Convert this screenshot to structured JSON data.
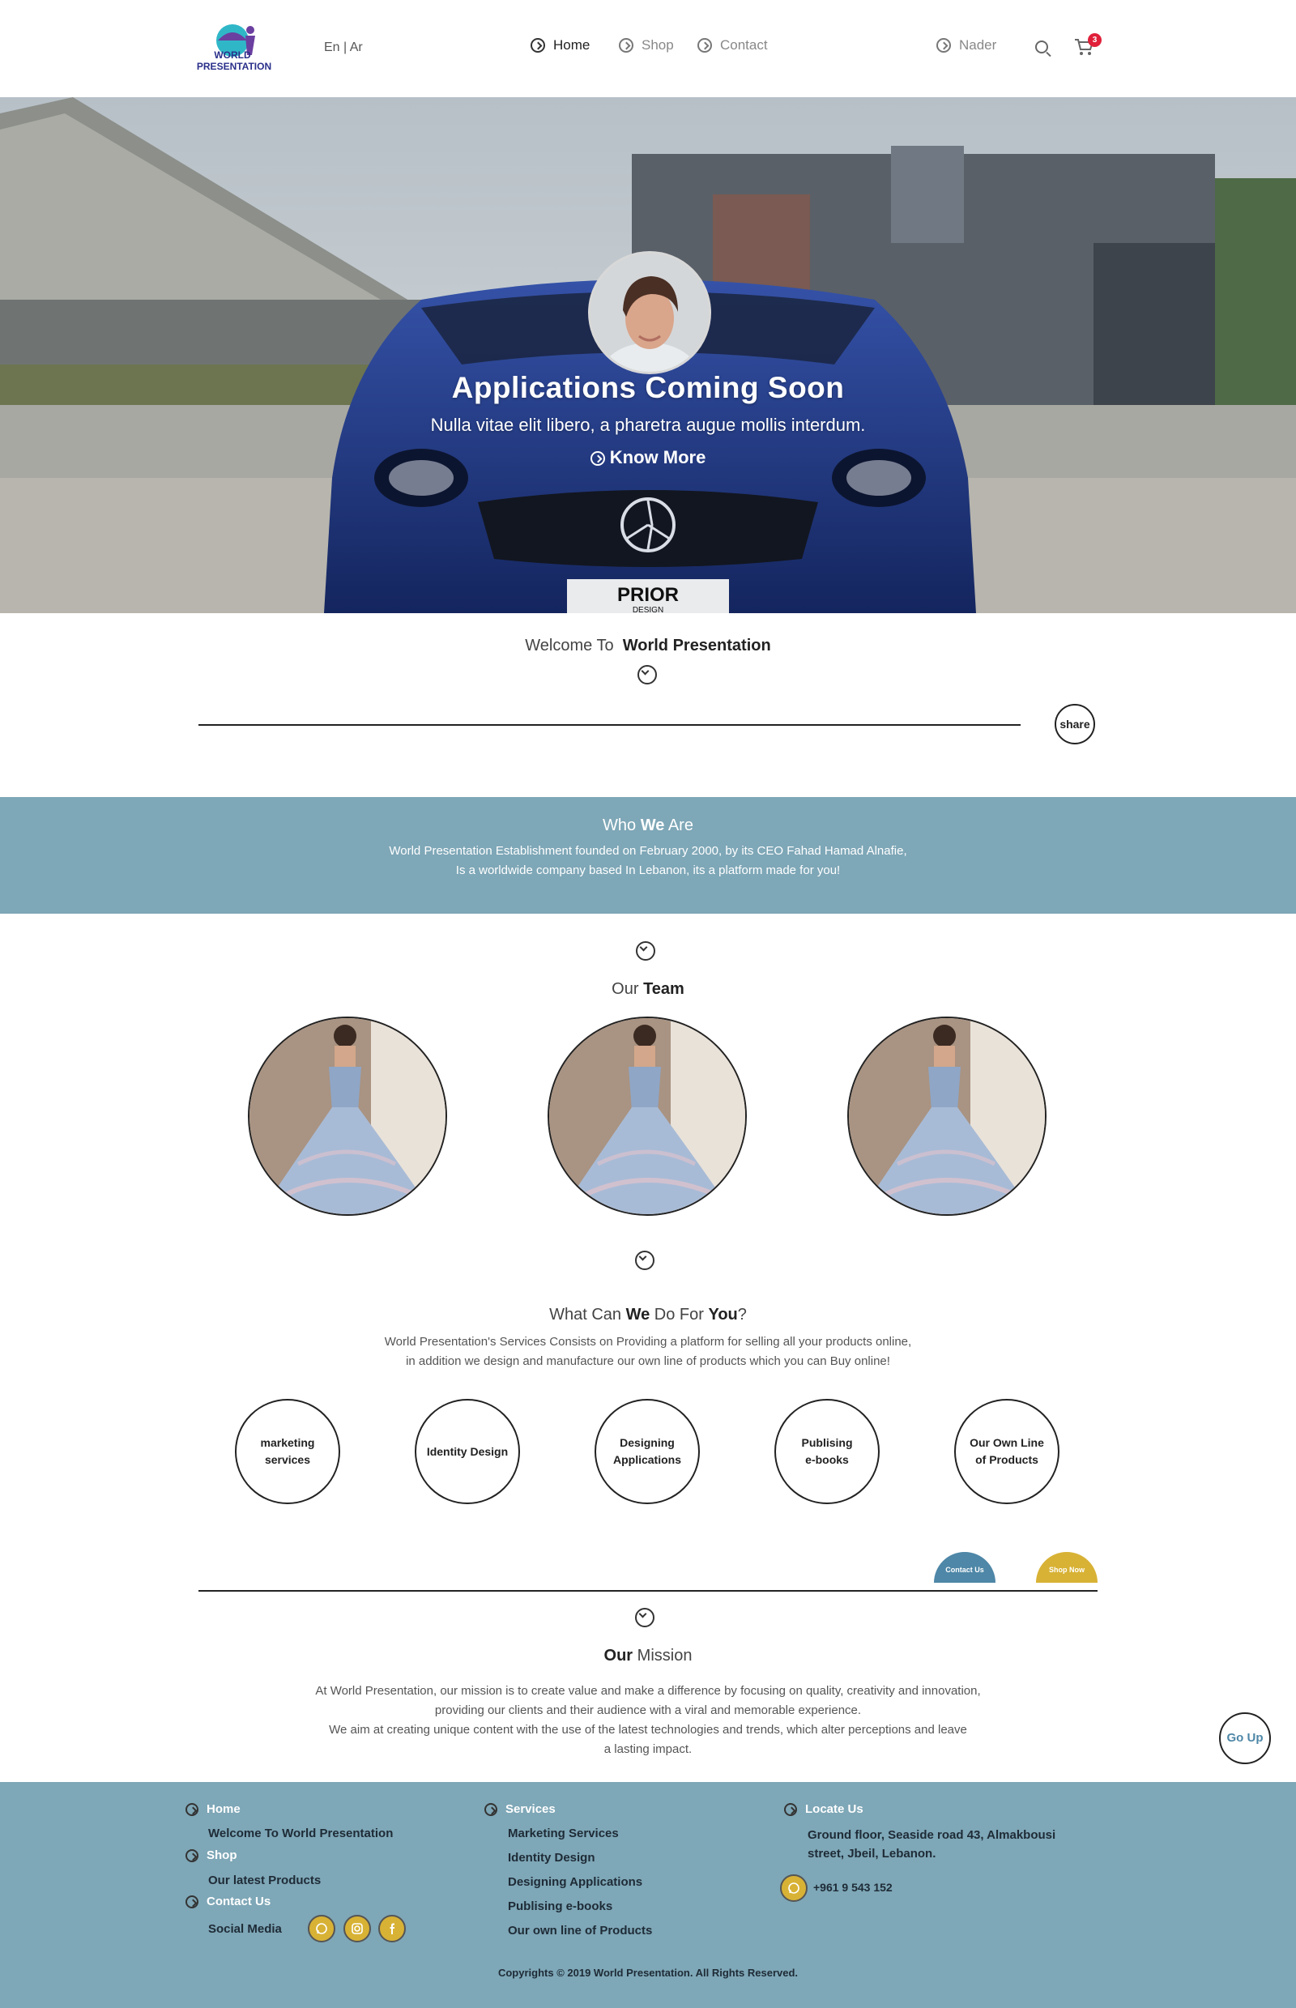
{
  "header": {
    "logo_text_top": "WORLD",
    "logo_text_bottom": "PRESENTATION",
    "lang": "En | Ar",
    "nav": [
      {
        "label": "Home"
      },
      {
        "label": "Shop"
      },
      {
        "label": "Contact"
      }
    ],
    "user": "Nader",
    "cart_count": "3"
  },
  "hero": {
    "title": "Applications Coming Soon",
    "subtitle": "Nulla vitae elit libero, a pharetra augue mollis interdum.",
    "link": "Know More",
    "plate_top": "PRIOR",
    "plate_bottom": "DESIGN"
  },
  "welcome": {
    "prefix": "Welcome To",
    "name": "World Presentation",
    "share": "share"
  },
  "who": {
    "title_a": "Who",
    "title_b": "We",
    "title_c": "Are",
    "line1": "World Presentation Establishment founded on February 2000, by its CEO Fahad Hamad Alnafie,",
    "line2": "Is a worldwide company based In Lebanon, its a platform made for you!"
  },
  "team": {
    "title_a": "Our",
    "title_b": "Team"
  },
  "services": {
    "title_a": "What Can",
    "title_b": "We",
    "title_c": "Do For",
    "title_d": "You",
    "title_e": "?",
    "line1": "World Presentation's Services Consists on Providing a platform for selling all your products online,",
    "line2": "in addition we design and manufacture our own line of products which you can Buy online!",
    "items": [
      {
        "l1": "marketing",
        "l2": "services"
      },
      {
        "l1": "Identity Design",
        "l2": ""
      },
      {
        "l1": "Designing",
        "l2": "Applications"
      },
      {
        "l1": "Publising",
        "l2": "e-books"
      },
      {
        "l1": "Our Own Line",
        "l2": "of Products"
      }
    ],
    "contact_btn": "Contact Us",
    "shop_btn": "Shop Now"
  },
  "mission": {
    "title_a": "Our",
    "title_b": "Mission",
    "line1": "At World Presentation, our mission is to create value and make a difference by focusing on quality, creativity and innovation,",
    "line2": "providing our clients and their audience with a viral and memorable experience.",
    "line3": "We aim at creating unique content with the use of the latest technologies and trends, which alter perceptions and leave",
    "line4": "a lasting impact.",
    "goup": "Go Up"
  },
  "footer": {
    "col1": {
      "home": "Home",
      "home_sub": "Welcome To World Presentation",
      "shop": "Shop",
      "shop_sub": "Our latest Products",
      "contact": "Contact Us",
      "social": "Social Media"
    },
    "col2": {
      "head": "Services",
      "items": [
        "Marketing Services",
        "Identity Design",
        "Designing Applications",
        "Publising e-books",
        "Our own line of Products"
      ]
    },
    "col3": {
      "head": "Locate Us",
      "addr1": "Ground floor, Seaside road 43, Almakbousi",
      "addr2": "street, Jbeil, Lebanon.",
      "phone": "+961 9 543 152"
    },
    "copyright": "Copyrights © 2019 World Presentation. All Rights Reserved."
  },
  "colors": {
    "accent_blue": "#7ea7b7",
    "badge_red": "#e0203a",
    "contact_btn": "#4e87a7",
    "shop_btn": "#d8b235"
  }
}
